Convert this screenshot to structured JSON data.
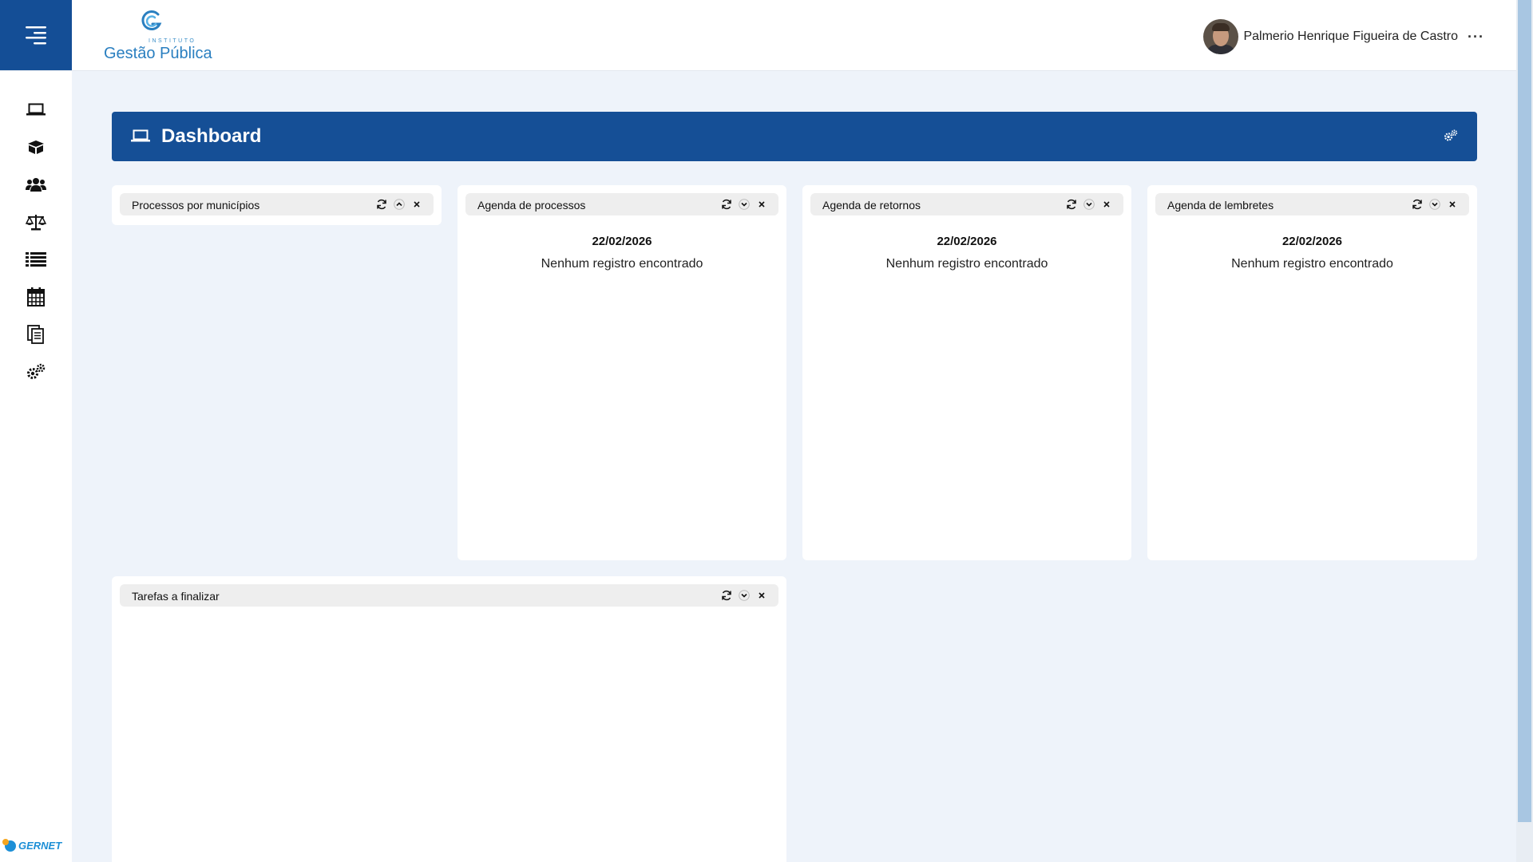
{
  "app": {
    "logo_small": "INSTITUTO",
    "logo_text": "Gestão Pública",
    "footer_brand": "GERNET"
  },
  "user": {
    "name": "Palmerio Henrique Figueira de Castro",
    "more": "···"
  },
  "sidebar": {
    "items": [
      {
        "icon": "laptop-icon"
      },
      {
        "icon": "box-icon"
      },
      {
        "icon": "users-icon"
      },
      {
        "icon": "scale-icon"
      },
      {
        "icon": "list-icon"
      },
      {
        "icon": "calendar-icon"
      },
      {
        "icon": "documents-icon"
      },
      {
        "icon": "gears-icon"
      }
    ]
  },
  "page": {
    "title": "Dashboard",
    "header_color": "#154f96"
  },
  "widgets": [
    {
      "title": "Processos por municípios",
      "toggle": "chevron-up-icon"
    },
    {
      "title": "Agenda de processos",
      "date": "22/02/2026",
      "empty": "Nenhum registro encontrado",
      "toggle": "chevron-down-icon"
    },
    {
      "title": "Agenda de retornos",
      "date": "22/02/2026",
      "empty": "Nenhum registro encontrado",
      "toggle": "chevron-down-icon"
    },
    {
      "title": "Agenda de lembretes",
      "date": "22/02/2026",
      "empty": "Nenhum registro encontrado",
      "toggle": "chevron-down-icon"
    },
    {
      "title": "Tarefas a finalizar",
      "toggle": "chevron-down-icon"
    }
  ]
}
